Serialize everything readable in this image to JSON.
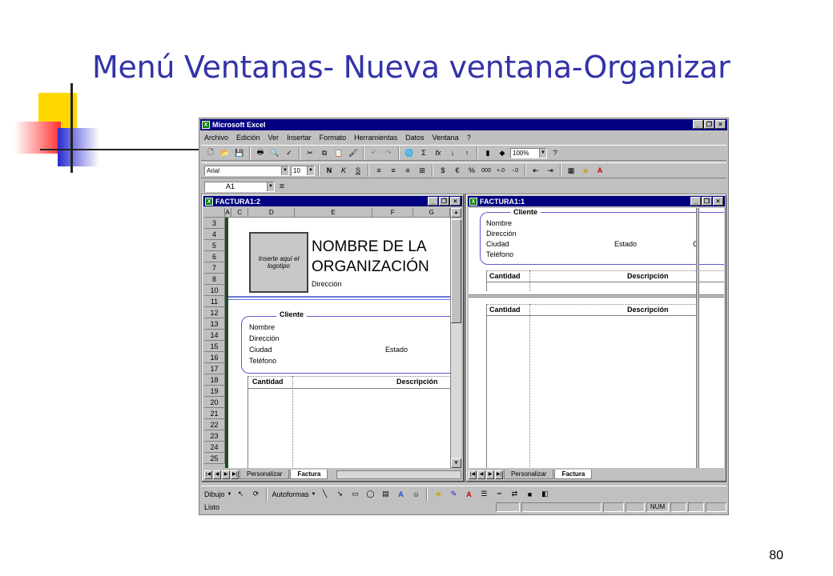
{
  "slide": {
    "title": "Menú Ventanas- Nueva ventana-Organizar",
    "page_number": "80"
  },
  "app": {
    "title": "Microsoft Excel"
  },
  "menu": [
    "Archivo",
    "Edición",
    "Ver",
    "Insertar",
    "Formato",
    "Herramientas",
    "Datos",
    "Ventana",
    "?"
  ],
  "toolbar": {
    "zoom": "100%",
    "font_name": "Arial",
    "font_size": "10"
  },
  "formula_bar": {
    "cell_ref": "A1",
    "equals": "="
  },
  "window_left": {
    "title": "FACTURA1:2",
    "columns": [
      "A",
      "C",
      "D",
      "E",
      "F",
      "G"
    ],
    "rows": [
      "3",
      "4",
      "5",
      "6",
      "7",
      "8",
      "10",
      "11",
      "12",
      "13",
      "14",
      "15",
      "16",
      "17",
      "18",
      "19",
      "20",
      "21",
      "22",
      "23",
      "24",
      "25"
    ],
    "logo_text": "Inserte aquí el logotipo",
    "org_name": "NOMBRE DE LA ORGANIZACIÓN",
    "address": "Dirección",
    "client_header": "Cliente",
    "client_fields": [
      "Nombre",
      "Dirección",
      "Ciudad",
      "Teléfono"
    ],
    "state_label": "Estado",
    "table_headers": [
      "Cantidad",
      "Descripción"
    ],
    "tabs": [
      "Personalizar",
      "Factura"
    ]
  },
  "window_right": {
    "title": "FACTURA1:1",
    "client_header": "Cliente",
    "client_fields": [
      "Nombre",
      "Dirección",
      "Ciudad",
      "Teléfono"
    ],
    "state_label": "Estado",
    "c_label": "C",
    "table_headers": [
      "Cantidad",
      "Descripción"
    ],
    "tabs": [
      "Personalizar",
      "Factura"
    ]
  },
  "drawing_bar": {
    "draw": "Dibujo",
    "autoshapes": "Autoformas"
  },
  "status": {
    "ready": "Listo",
    "num": "NUM"
  },
  "colors": {
    "title_blue": "#3333a8",
    "titlebar": "#000080",
    "frame_gray": "#c0c0c0"
  }
}
